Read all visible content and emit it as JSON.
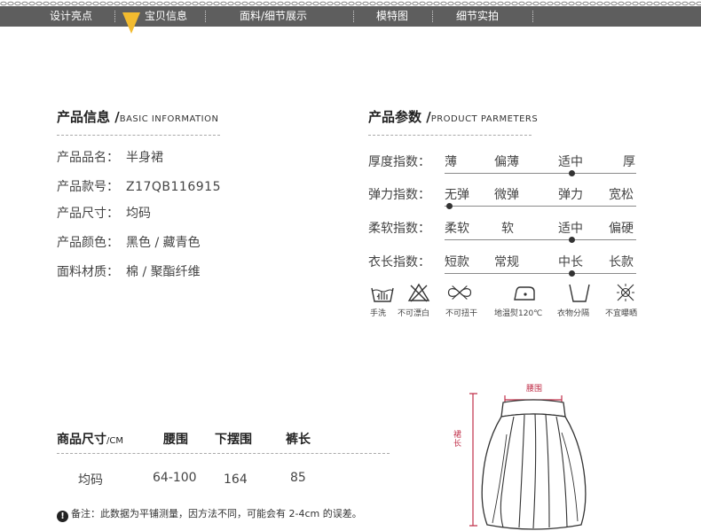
{
  "nav": {
    "items": [
      "设计亮点",
      "宝贝信息",
      "面料/细节展示",
      "模特图",
      "细节实拍"
    ],
    "active_index": 1,
    "colors": {
      "bar": "#5e5e5e",
      "arrow": "#f2bb2f"
    }
  },
  "product_info": {
    "title": "产品信息 /",
    "title_en": "BASIC INFORMATION",
    "rows": [
      {
        "label": "产品品名：",
        "value": "半身裙"
      },
      {
        "label": "产品款号：",
        "value": "Z17QB116915"
      },
      {
        "label": "产品尺寸：",
        "value": "均码"
      },
      {
        "label": "产品颜色：",
        "value": "黑色 / 藏青色"
      },
      {
        "label": "面料材质：",
        "value": "棉 / 聚酯纤维"
      }
    ]
  },
  "product_params": {
    "title": "产品参数 /",
    "title_en": "PRODUCT PARMETERS",
    "scales": [
      {
        "label": "厚度指数：",
        "options": [
          "薄",
          "偏薄",
          "适中",
          "厚"
        ],
        "selected": 2
      },
      {
        "label": "弹力指数：",
        "options": [
          "无弹",
          "微弹",
          "弹力",
          "宽松"
        ],
        "selected": 0
      },
      {
        "label": "柔软指数：",
        "options": [
          "柔软",
          "软",
          "适中",
          "偏硬"
        ],
        "selected": 2
      },
      {
        "label": "衣长指数：",
        "options": [
          "短款",
          "常规",
          "中长",
          "长款"
        ],
        "selected": 2
      }
    ]
  },
  "care": [
    {
      "icon": "hand-wash-icon",
      "label": "手洗"
    },
    {
      "icon": "no-bleach-icon",
      "label": "不可漂白"
    },
    {
      "icon": "no-wring-icon",
      "label": "不可扭干"
    },
    {
      "icon": "iron-low-temp-icon",
      "label": "地温熨120℃"
    },
    {
      "icon": "wash-separately-icon",
      "label": "衣物分隔"
    },
    {
      "icon": "no-sun-dry-icon",
      "label": "不宜曝晒"
    }
  ],
  "size_table": {
    "headers": [
      "商品尺寸",
      "腰围",
      "下摆围",
      "裤长"
    ],
    "unit": "/CM",
    "rows": [
      [
        "均码",
        "64-100",
        "164",
        "85"
      ]
    ]
  },
  "note": {
    "text": "备注：此数据为平铺测量，因方法不同，可能会有 2-4cm 的误差。"
  },
  "diagram": {
    "waist_label": "腰围",
    "length_label": "裙长",
    "colors": {
      "dimension": "#c0304a"
    }
  }
}
